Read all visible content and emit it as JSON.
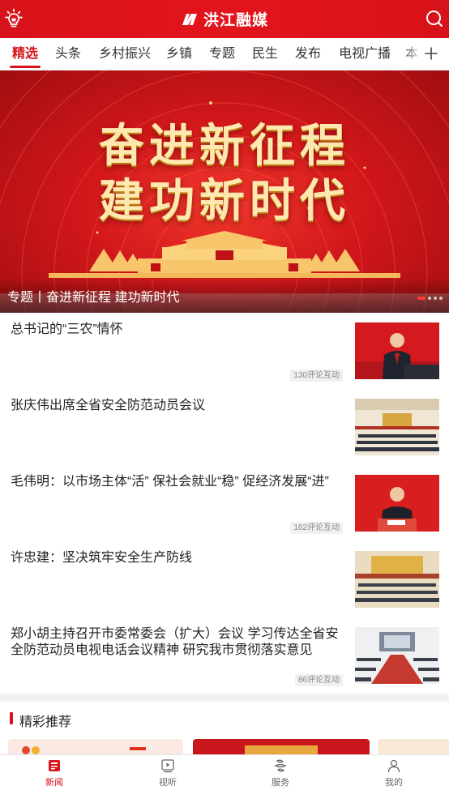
{
  "header": {
    "logo_text": "洪江融媒",
    "left_icon": "lightbulb-icon",
    "right_icon": "search-icon"
  },
  "tabs": [
    {
      "label": "精选",
      "active": true
    },
    {
      "label": "头条"
    },
    {
      "label": "乡村振兴"
    },
    {
      "label": "乡镇"
    },
    {
      "label": "专题"
    },
    {
      "label": "民生"
    },
    {
      "label": "发布"
    },
    {
      "label": "电视广播"
    },
    {
      "label": "本"
    }
  ],
  "tab_add_icon": "plus-icon",
  "banner": {
    "headline_line1": "奋进新征程",
    "headline_line2": "建功新时代",
    "caption": "专题丨奋进新征程 建功新时代",
    "slide_count": 4,
    "active_slide": 1
  },
  "news": [
    {
      "title": "总书记的“三农”情怀",
      "badge": "130评论互动"
    },
    {
      "title": "张庆伟出席全省安全防范动员会议",
      "badge": ""
    },
    {
      "title": "毛伟明：以市场主体“活” 保社会就业“稳” 促经济发展“进”",
      "badge": "162评论互动"
    },
    {
      "title": "许忠建：坚决筑牢安全生产防线",
      "badge": ""
    },
    {
      "title": "郑小胡主持召开市委常委会（扩大）会议 学习传达全省安全防范动员电视电话会议精神 研究我市贯彻落实意见",
      "badge": "86评论互动"
    }
  ],
  "recommend": {
    "title": "精彩推荐"
  },
  "bottom_nav": [
    {
      "label": "新闻",
      "icon": "news-icon",
      "active": true
    },
    {
      "label": "视听",
      "icon": "video-icon"
    },
    {
      "label": "服务",
      "icon": "service-icon"
    },
    {
      "label": "我的",
      "icon": "profile-icon"
    }
  ],
  "colors": {
    "brand_red": "#d8121a",
    "banner_gold": "#ffe7b0"
  }
}
